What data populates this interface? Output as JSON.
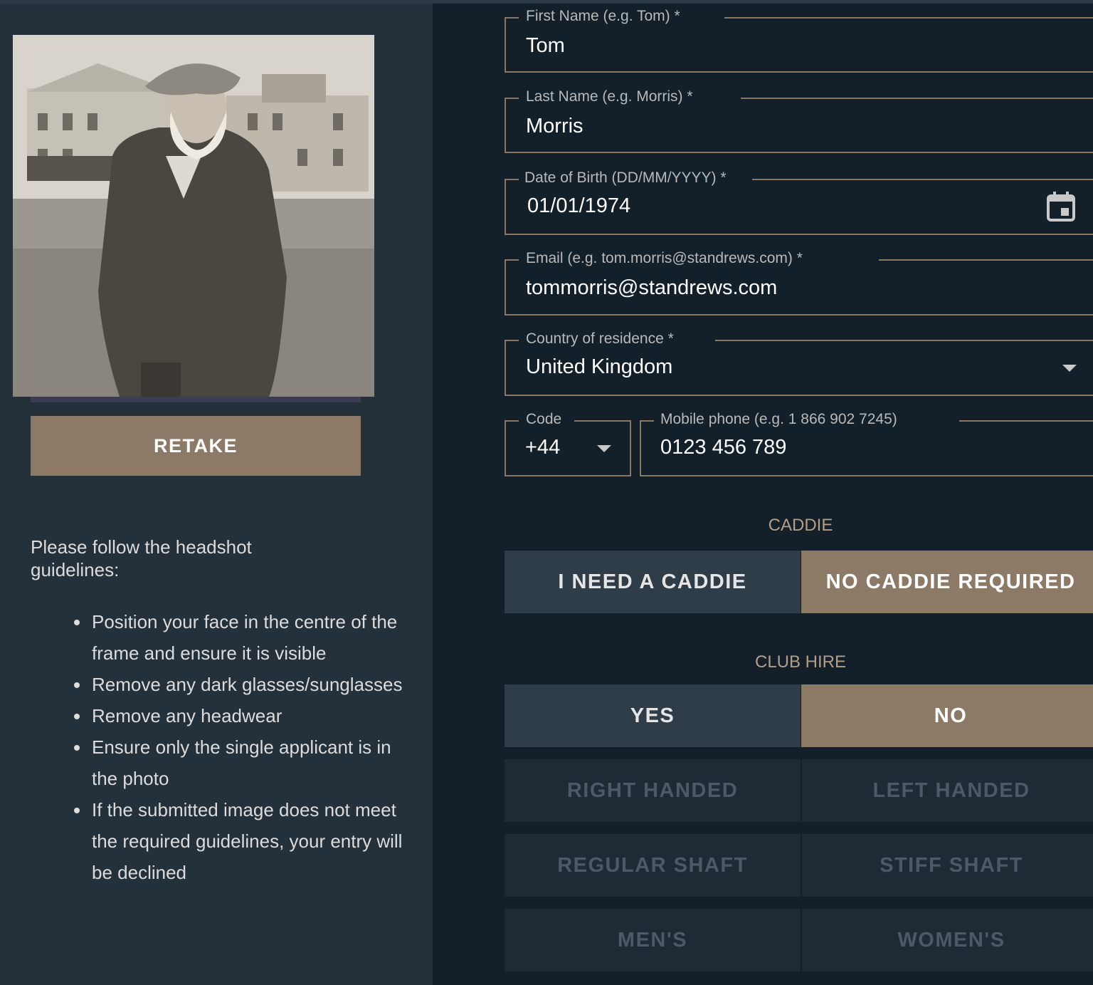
{
  "left": {
    "retake_label": "RETAKE",
    "guidelines_intro": "Please follow the headshot guidelines:",
    "guidelines": [
      "Position your face in the centre of the frame and ensure it is visible",
      "Remove any dark glasses/sunglasses",
      "Remove any headwear",
      "Ensure only the single applicant is in the photo",
      "If the submitted image does not meet the required guidelines, your entry will be declined"
    ]
  },
  "form": {
    "first_name": {
      "label": "First Name (e.g. Tom) *",
      "value": "Tom"
    },
    "last_name": {
      "label": "Last Name (e.g. Morris) *",
      "value": "Morris"
    },
    "dob": {
      "label": "Date of Birth (DD/MM/YYYY) *",
      "value": "01/01/1974",
      "icon": "calendar-icon"
    },
    "email": {
      "label": "Email (e.g. tom.morris@standrews.com) *",
      "value": "tommorris@standrews.com"
    },
    "country": {
      "label": "Country of residence *",
      "value": "United Kingdom",
      "icon": "chevron-down-icon"
    },
    "code": {
      "label": "Code",
      "value": "+44"
    },
    "mobile": {
      "label": "Mobile phone (e.g. 1 866 902 7245)",
      "value": "0123 456 789"
    }
  },
  "caddie": {
    "title": "CADDIE",
    "options": [
      "I NEED A CADDIE",
      "NO CADDIE REQUIRED"
    ],
    "selected": "NO CADDIE REQUIRED"
  },
  "club_hire": {
    "title": "CLUB HIRE",
    "options": [
      "YES",
      "NO"
    ],
    "selected": "NO",
    "handedness": [
      "RIGHT HANDED",
      "LEFT HANDED"
    ],
    "shaft": [
      "REGULAR SHAFT",
      "STIFF SHAFT"
    ],
    "gender": [
      "MEN'S",
      "WOMEN'S"
    ]
  },
  "colors": {
    "accent": "#8c7a66",
    "background": "#13202a",
    "panel": "#24303a",
    "label_accent": "#b59e85"
  }
}
